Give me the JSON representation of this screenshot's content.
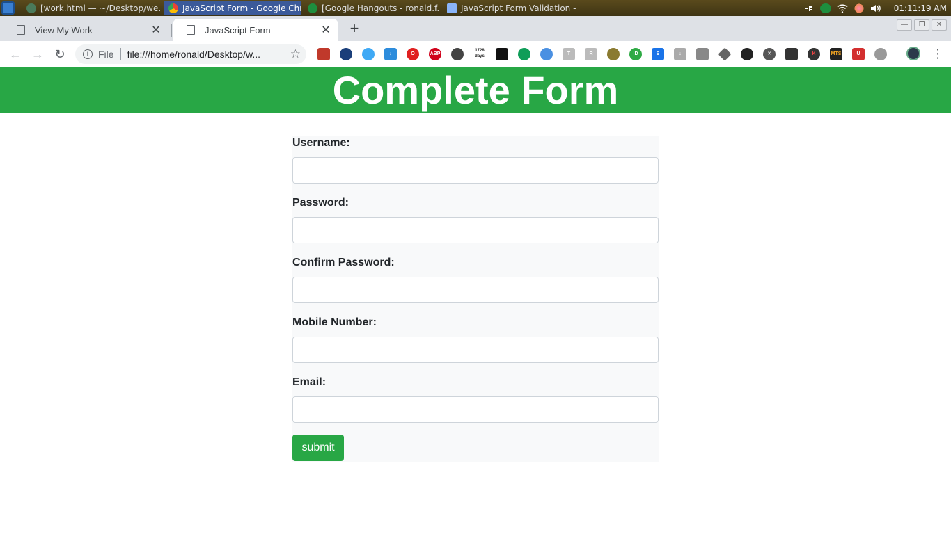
{
  "taskbar": {
    "tasks": [
      {
        "label": "[work.html — ~/Desktop/we...",
        "icon": "atom-icon",
        "color": "#4a7a5a"
      },
      {
        "label": "JavaScript Form - Google Chr...",
        "icon": "chrome-icon",
        "color": "#e0c030"
      },
      {
        "label": "[Google Hangouts - ronald.f...",
        "icon": "hangouts-icon",
        "color": "#1e8e3e"
      },
      {
        "label": "JavaScript Form Validation - ...",
        "icon": "folder-icon",
        "color": "#8ab4f8"
      }
    ],
    "clock": "01:11:19 AM"
  },
  "browser": {
    "tabs": [
      {
        "title": "View My Work",
        "close": "✕"
      },
      {
        "title": "JavaScript Form",
        "close": "✕"
      }
    ],
    "new_tab": "+",
    "scheme": "File",
    "url": "file:///home/ronald/Desktop/w...",
    "ext_1728": "1728 days",
    "ext_abp": "ABP",
    "ext_mts": "MTS"
  },
  "page": {
    "heading": "Complete Form",
    "fields": [
      {
        "label": "Username:",
        "value": ""
      },
      {
        "label": "Password:",
        "value": ""
      },
      {
        "label": "Confirm Password:",
        "value": ""
      },
      {
        "label": "Mobile Number:",
        "value": ""
      },
      {
        "label": "Email:",
        "value": ""
      }
    ],
    "submit_label": "submit"
  },
  "colors": {
    "accent_green": "#28a745",
    "form_background": "#f8f9fa",
    "input_border": "#ced4da"
  }
}
